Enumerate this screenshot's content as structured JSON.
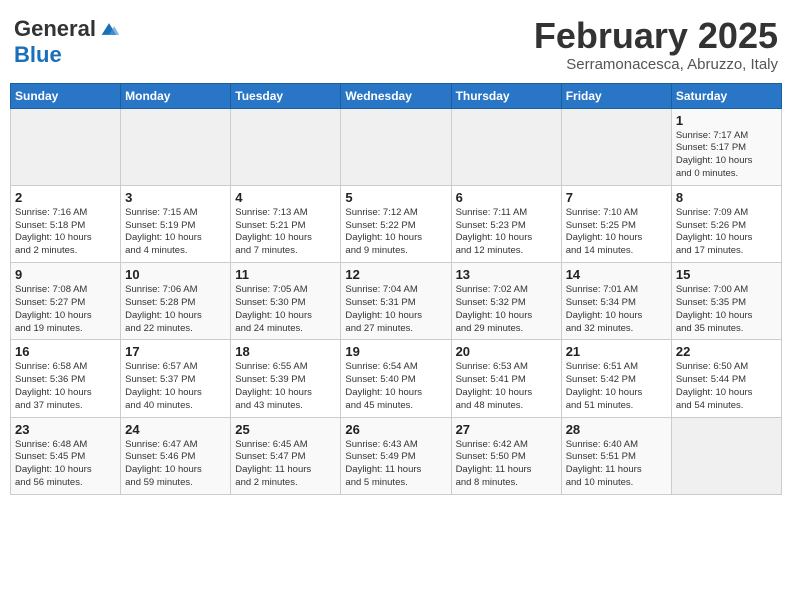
{
  "header": {
    "logo_general": "General",
    "logo_blue": "Blue",
    "month_title": "February 2025",
    "location": "Serramonacesca, Abruzzo, Italy"
  },
  "weekdays": [
    "Sunday",
    "Monday",
    "Tuesday",
    "Wednesday",
    "Thursday",
    "Friday",
    "Saturday"
  ],
  "weeks": [
    [
      {
        "day": "",
        "info": ""
      },
      {
        "day": "",
        "info": ""
      },
      {
        "day": "",
        "info": ""
      },
      {
        "day": "",
        "info": ""
      },
      {
        "day": "",
        "info": ""
      },
      {
        "day": "",
        "info": ""
      },
      {
        "day": "1",
        "info": "Sunrise: 7:17 AM\nSunset: 5:17 PM\nDaylight: 10 hours\nand 0 minutes."
      }
    ],
    [
      {
        "day": "2",
        "info": "Sunrise: 7:16 AM\nSunset: 5:18 PM\nDaylight: 10 hours\nand 2 minutes."
      },
      {
        "day": "3",
        "info": "Sunrise: 7:15 AM\nSunset: 5:19 PM\nDaylight: 10 hours\nand 4 minutes."
      },
      {
        "day": "4",
        "info": "Sunrise: 7:13 AM\nSunset: 5:21 PM\nDaylight: 10 hours\nand 7 minutes."
      },
      {
        "day": "5",
        "info": "Sunrise: 7:12 AM\nSunset: 5:22 PM\nDaylight: 10 hours\nand 9 minutes."
      },
      {
        "day": "6",
        "info": "Sunrise: 7:11 AM\nSunset: 5:23 PM\nDaylight: 10 hours\nand 12 minutes."
      },
      {
        "day": "7",
        "info": "Sunrise: 7:10 AM\nSunset: 5:25 PM\nDaylight: 10 hours\nand 14 minutes."
      },
      {
        "day": "8",
        "info": "Sunrise: 7:09 AM\nSunset: 5:26 PM\nDaylight: 10 hours\nand 17 minutes."
      }
    ],
    [
      {
        "day": "9",
        "info": "Sunrise: 7:08 AM\nSunset: 5:27 PM\nDaylight: 10 hours\nand 19 minutes."
      },
      {
        "day": "10",
        "info": "Sunrise: 7:06 AM\nSunset: 5:28 PM\nDaylight: 10 hours\nand 22 minutes."
      },
      {
        "day": "11",
        "info": "Sunrise: 7:05 AM\nSunset: 5:30 PM\nDaylight: 10 hours\nand 24 minutes."
      },
      {
        "day": "12",
        "info": "Sunrise: 7:04 AM\nSunset: 5:31 PM\nDaylight: 10 hours\nand 27 minutes."
      },
      {
        "day": "13",
        "info": "Sunrise: 7:02 AM\nSunset: 5:32 PM\nDaylight: 10 hours\nand 29 minutes."
      },
      {
        "day": "14",
        "info": "Sunrise: 7:01 AM\nSunset: 5:34 PM\nDaylight: 10 hours\nand 32 minutes."
      },
      {
        "day": "15",
        "info": "Sunrise: 7:00 AM\nSunset: 5:35 PM\nDaylight: 10 hours\nand 35 minutes."
      }
    ],
    [
      {
        "day": "16",
        "info": "Sunrise: 6:58 AM\nSunset: 5:36 PM\nDaylight: 10 hours\nand 37 minutes."
      },
      {
        "day": "17",
        "info": "Sunrise: 6:57 AM\nSunset: 5:37 PM\nDaylight: 10 hours\nand 40 minutes."
      },
      {
        "day": "18",
        "info": "Sunrise: 6:55 AM\nSunset: 5:39 PM\nDaylight: 10 hours\nand 43 minutes."
      },
      {
        "day": "19",
        "info": "Sunrise: 6:54 AM\nSunset: 5:40 PM\nDaylight: 10 hours\nand 45 minutes."
      },
      {
        "day": "20",
        "info": "Sunrise: 6:53 AM\nSunset: 5:41 PM\nDaylight: 10 hours\nand 48 minutes."
      },
      {
        "day": "21",
        "info": "Sunrise: 6:51 AM\nSunset: 5:42 PM\nDaylight: 10 hours\nand 51 minutes."
      },
      {
        "day": "22",
        "info": "Sunrise: 6:50 AM\nSunset: 5:44 PM\nDaylight: 10 hours\nand 54 minutes."
      }
    ],
    [
      {
        "day": "23",
        "info": "Sunrise: 6:48 AM\nSunset: 5:45 PM\nDaylight: 10 hours\nand 56 minutes."
      },
      {
        "day": "24",
        "info": "Sunrise: 6:47 AM\nSunset: 5:46 PM\nDaylight: 10 hours\nand 59 minutes."
      },
      {
        "day": "25",
        "info": "Sunrise: 6:45 AM\nSunset: 5:47 PM\nDaylight: 11 hours\nand 2 minutes."
      },
      {
        "day": "26",
        "info": "Sunrise: 6:43 AM\nSunset: 5:49 PM\nDaylight: 11 hours\nand 5 minutes."
      },
      {
        "day": "27",
        "info": "Sunrise: 6:42 AM\nSunset: 5:50 PM\nDaylight: 11 hours\nand 8 minutes."
      },
      {
        "day": "28",
        "info": "Sunrise: 6:40 AM\nSunset: 5:51 PM\nDaylight: 11 hours\nand 10 minutes."
      },
      {
        "day": "",
        "info": ""
      }
    ]
  ]
}
